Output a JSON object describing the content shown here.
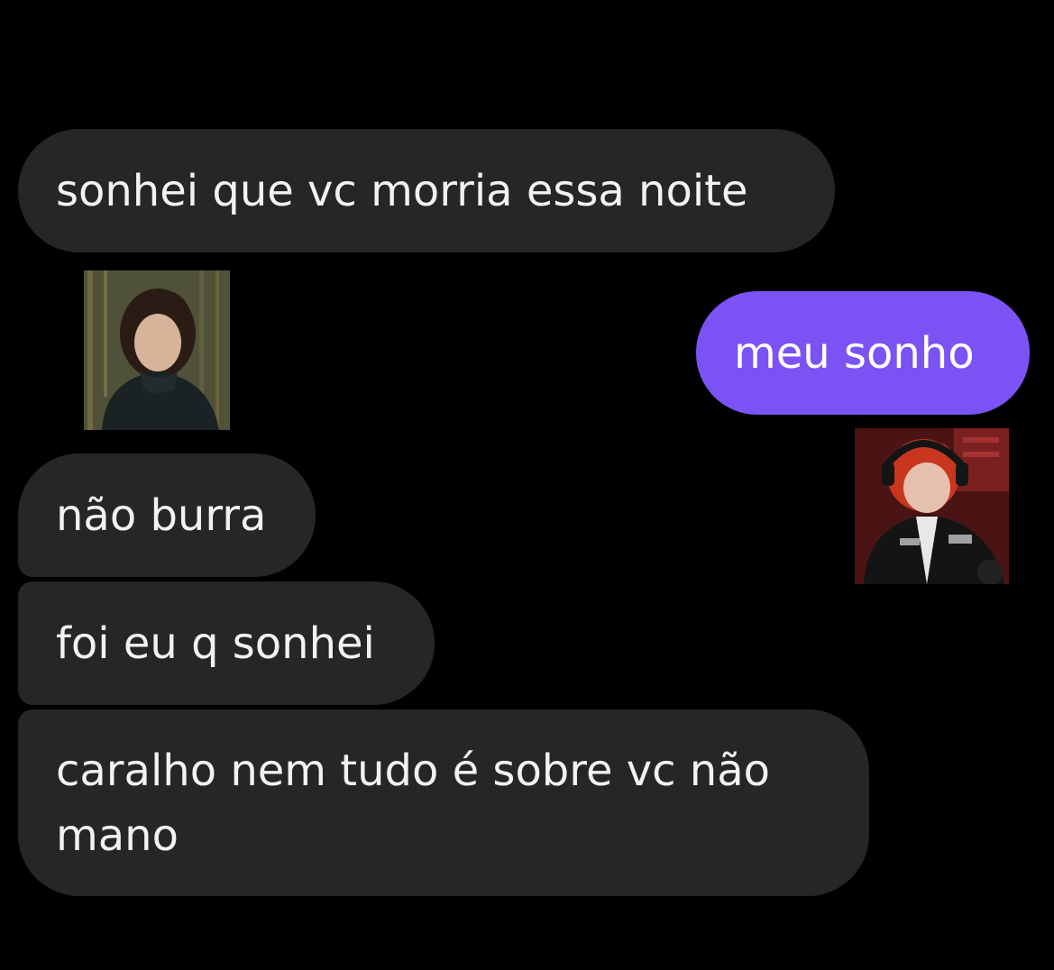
{
  "messages": [
    {
      "id": "m1",
      "sender": "other",
      "text": "sonhei que vc morria essa noite"
    },
    {
      "id": "m2",
      "sender": "me",
      "text": "meu sonho"
    },
    {
      "id": "m3",
      "sender": "other",
      "text": "não burra"
    },
    {
      "id": "m4",
      "sender": "other",
      "text": "foi eu q sonhei"
    },
    {
      "id": "m5",
      "sender": "other",
      "text_lines": [
        "caralho nem tudo é sobre vc não",
        "mano"
      ]
    }
  ],
  "avatars": {
    "left": {
      "icon": "person-photo-dark-hair"
    },
    "right": {
      "icon": "person-photo-red-hair-headphones"
    }
  },
  "colors": {
    "background": "#000000",
    "incoming_bubble": "#262628",
    "outgoing_bubble": "#7b53f5",
    "text": "#f2f2f2"
  }
}
